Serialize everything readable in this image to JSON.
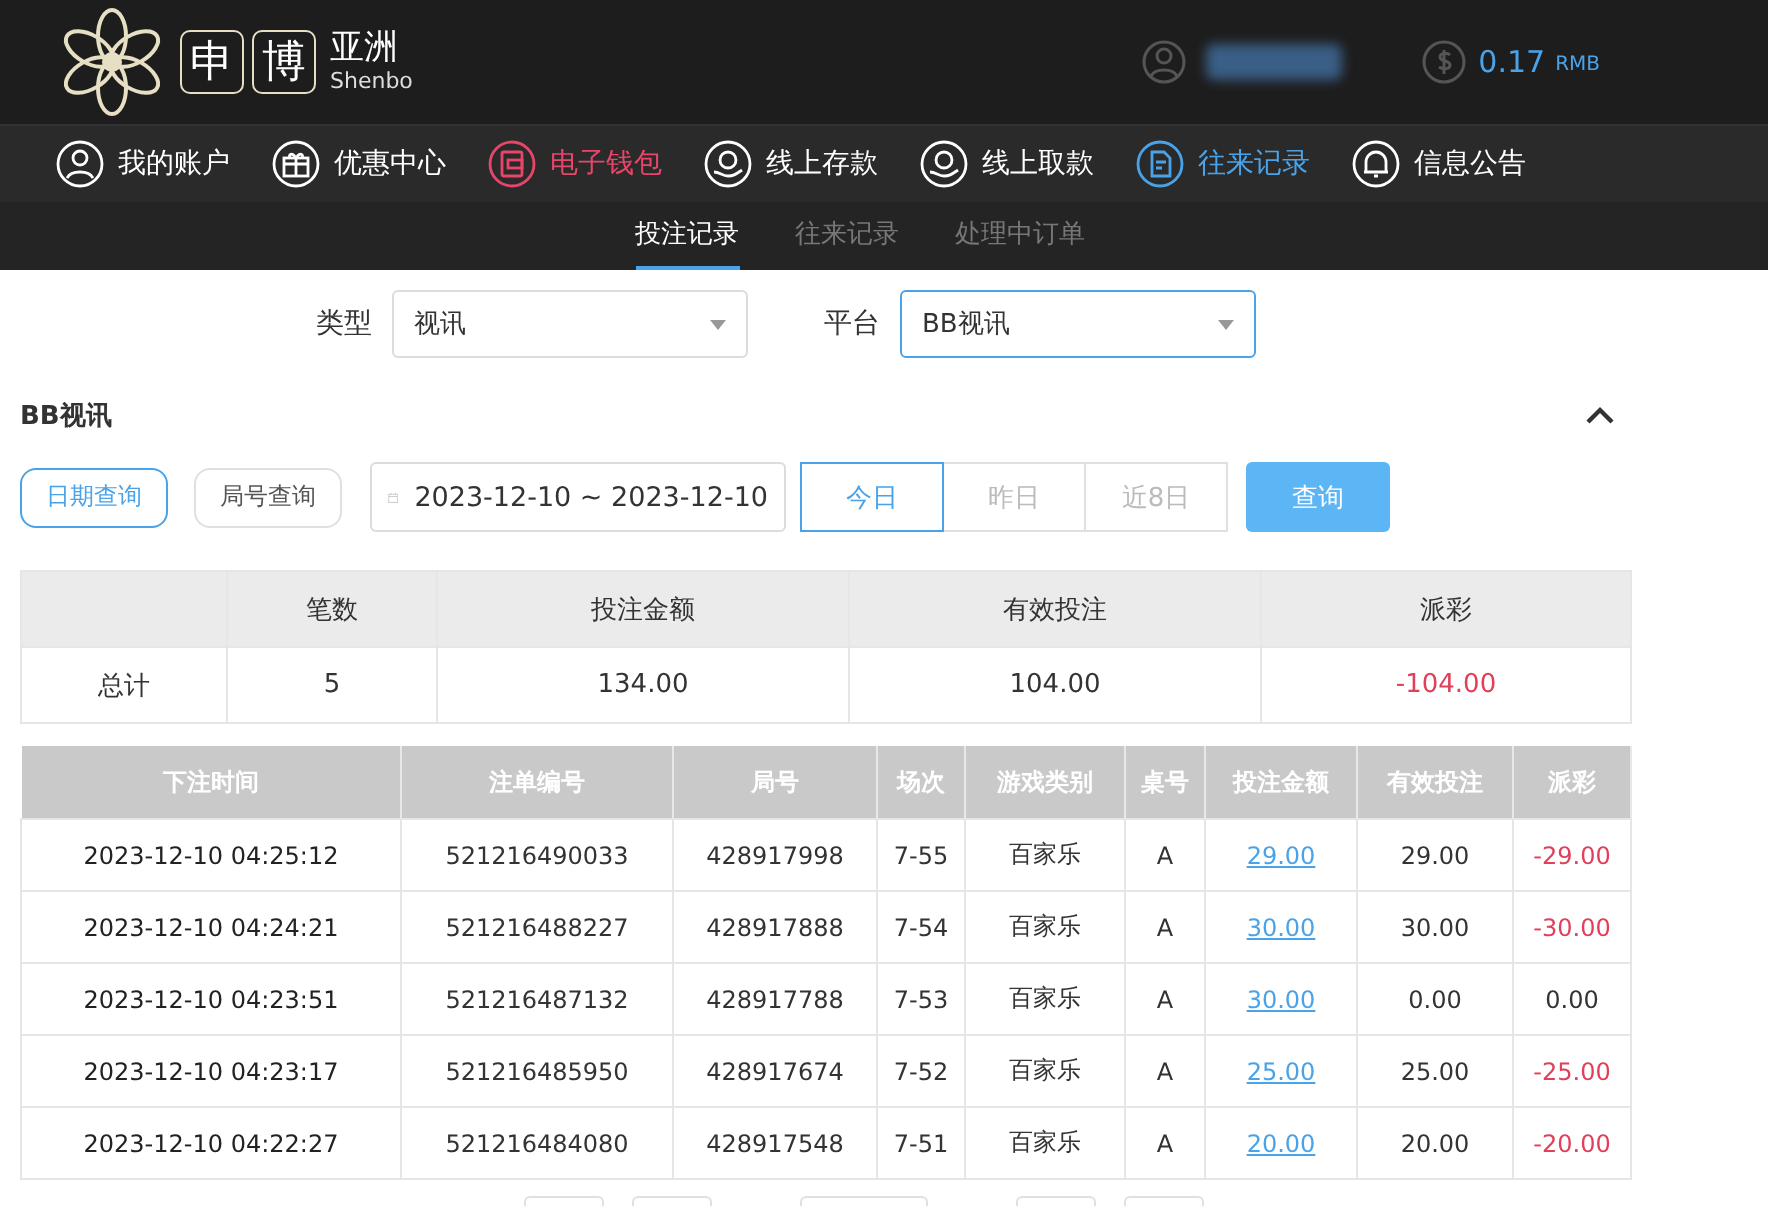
{
  "header": {
    "logo_chars": [
      "申",
      "博"
    ],
    "logo_title": "亚洲",
    "logo_sub": "Shenbo",
    "balance": "0.17",
    "currency": "RMB"
  },
  "nav": [
    {
      "label": "我的账户",
      "kind": "user",
      "color": "#ffffff"
    },
    {
      "label": "优惠中心",
      "kind": "gift",
      "color": "#ffffff"
    },
    {
      "label": "电子钱包",
      "kind": "wallet",
      "color": "#e8456a"
    },
    {
      "label": "线上存款",
      "kind": "deposit",
      "color": "#ffffff"
    },
    {
      "label": "线上取款",
      "kind": "withdraw",
      "color": "#ffffff"
    },
    {
      "label": "往来记录",
      "kind": "record",
      "color": "#4aa3e8"
    },
    {
      "label": "信息公告",
      "kind": "bell",
      "color": "#ffffff"
    }
  ],
  "subtabs": [
    {
      "label": "投注记录",
      "selected": true
    },
    {
      "label": "往来记录",
      "selected": false
    },
    {
      "label": "处理中订单",
      "selected": false
    }
  ],
  "filters": [
    {
      "label": "类型",
      "value": "视讯",
      "focused": false
    },
    {
      "label": "平台",
      "value": "BB视讯",
      "focused": true
    }
  ],
  "section_title": "BB视讯",
  "query_modes": [
    {
      "label": "日期查询",
      "selected": true
    },
    {
      "label": "局号查询",
      "selected": false
    }
  ],
  "date_range": "2023-12-10 ~ 2023-12-10",
  "quick_dates": [
    {
      "label": "今日",
      "selected": true
    },
    {
      "label": "昨日",
      "selected": false
    },
    {
      "label": "近8日",
      "selected": false
    }
  ],
  "query_button": "查询",
  "summary": {
    "columns": [
      "笔数",
      "投注金额",
      "有效投注",
      "派彩"
    ],
    "label": "总计",
    "values": [
      "5",
      "134.00",
      "104.00",
      "-104.00"
    ],
    "payout_loss": true
  },
  "table": {
    "columns": [
      "下注时间",
      "注单编号",
      "局号",
      "场次",
      "游戏类别",
      "桌号",
      "投注金额",
      "有效投注",
      "派彩"
    ],
    "rows": [
      {
        "cells": [
          "2023-12-10 04:25:12",
          "521216490033",
          "428917998",
          "7-55",
          "百家乐",
          "A",
          "29.00",
          "29.00",
          "-29.00"
        ],
        "loss": true
      },
      {
        "cells": [
          "2023-12-10 04:24:21",
          "521216488227",
          "428917888",
          "7-54",
          "百家乐",
          "A",
          "30.00",
          "30.00",
          "-30.00"
        ],
        "loss": true
      },
      {
        "cells": [
          "2023-12-10 04:23:51",
          "521216487132",
          "428917788",
          "7-53",
          "百家乐",
          "A",
          "30.00",
          "0.00",
          "0.00"
        ],
        "loss": false
      },
      {
        "cells": [
          "2023-12-10 04:23:17",
          "521216485950",
          "428917674",
          "7-52",
          "百家乐",
          "A",
          "25.00",
          "25.00",
          "-25.00"
        ],
        "loss": true
      },
      {
        "cells": [
          "2023-12-10 04:22:27",
          "521216484080",
          "428917548",
          "7-51",
          "百家乐",
          "A",
          "20.00",
          "20.00",
          "-20.00"
        ],
        "loss": true
      }
    ]
  }
}
